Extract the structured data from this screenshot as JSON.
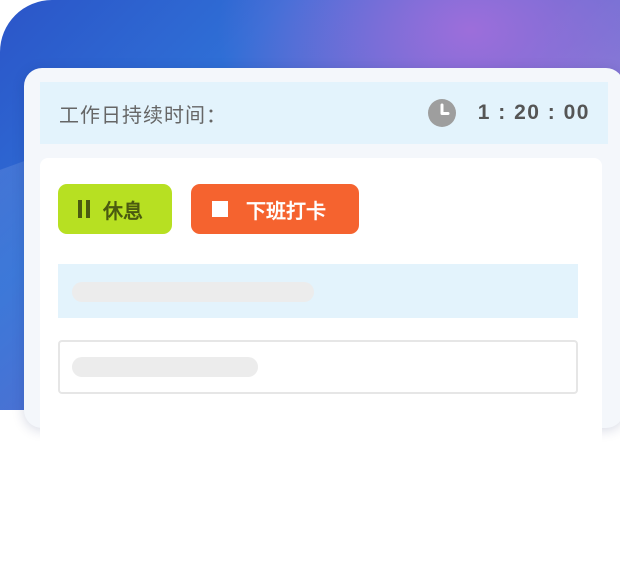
{
  "header": {
    "label": "工作日持续时间：",
    "timer_icon": "clock-icon",
    "duration": "1 : 20 : 00"
  },
  "actions": {
    "rest": {
      "label": "休息",
      "icon": "pause-icon",
      "color": "#b7e022"
    },
    "clock_out": {
      "label": "下班打卡",
      "icon": "stop-icon",
      "color": "#f5632f"
    }
  },
  "colors": {
    "header_bg": "#e3f3fc",
    "placeholder": "#ececec"
  }
}
